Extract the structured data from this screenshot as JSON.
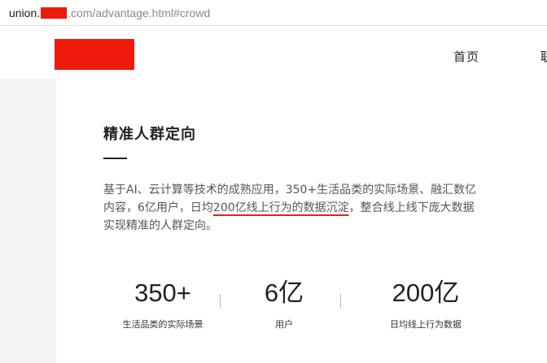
{
  "browser": {
    "url_host": "union.",
    "url_path": ".com/advantage.html#crowd"
  },
  "header": {
    "nav_home": "首页",
    "nav_next": "联"
  },
  "section": {
    "title": "精准人群定向",
    "description_line1": "基于AI、云计算等技术的成熟应用，350+生活品类的实际场景、融汇数亿",
    "description_line2_before": "内容，6亿用户，日均",
    "description_line2_highlight": "200亿线上行为的数据沉淀",
    "description_line2_after": "，整合线上线下庞大数据",
    "description_line3": "实现精准的人群定向。"
  },
  "colors": {
    "redaction": "#ee1a0c",
    "underline_accent": "#d9261c"
  },
  "stats": [
    {
      "value": "350+",
      "label": "生活品类的实际场景"
    },
    {
      "value": "6亿",
      "label": "用户"
    },
    {
      "value": "200亿",
      "label": "日均线上行为数据"
    }
  ]
}
